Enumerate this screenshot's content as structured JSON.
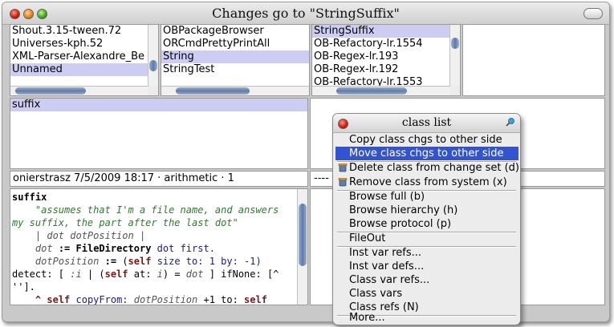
{
  "window": {
    "title": "Changes go to \"StringSuffix\""
  },
  "lists": {
    "changesets": [
      "Shout.3.15-tween.72",
      "Universes-kph.52",
      "XML-Parser-Alexandre_Be",
      "Unnamed"
    ],
    "classes": [
      "OBPackageBrowser",
      "ORCmdPrettyPrintAll",
      "String",
      "StringTest"
    ],
    "other_changesets": [
      "StringSuffix",
      "OB-Refactory-lr.1554",
      "OB-Regex-lr.193",
      "OB-Regex-lr.192",
      "OB-Refactory-lr.1553"
    ],
    "methods": [
      "suffix"
    ]
  },
  "info_line": "onierstrasz 7/5/2009 18:17 · arithmetic · 1",
  "right_info": "----",
  "code": {
    "selector": "suffix",
    "comment1": "\"assumes that I'm a file name, and answers",
    "comment2": "my suffix, the part after the last dot\"",
    "temps": "| dot dotPosition |",
    "l4_var": "dot",
    "l4_assign": ":=",
    "l4_class": "FileDirectory",
    "l4_rest": "dot first.",
    "l5_var": "dotPosition",
    "l5_assign": ":=",
    "l5_paren": "(",
    "l5_self": "self",
    "l5_rest": "size to: 1 by: -1)",
    "l6_a": "detect: [ ",
    "l6_b": ":i",
    "l6_c": " | (",
    "l6_d": "self",
    "l6_e": " at: ",
    "l6_f": "i",
    "l6_g": ") = ",
    "l6_h": "dot",
    "l6_i": " ] ifNone: [^",
    "l7": "''].",
    "l8_caret": "^",
    "l8_self": "self",
    "l8_a": " copyFrom: ",
    "l8_b": "dotPosition",
    "l8_c": " +1 to: ",
    "l8_d": "self"
  },
  "menu": {
    "title": "class list",
    "items": [
      "Copy class chgs to other side",
      "Move class chgs to other side",
      "Delete class from change set (d)",
      "Remove class from system (x)",
      "Browse full (b)",
      "Browse hierarchy (h)",
      "Browse protocol (p)",
      "FileOut",
      "Inst var refs...",
      "Inst var defs...",
      "Class var refs...",
      "Class vars",
      "Class refs (N)",
      "More..."
    ]
  },
  "colors": {
    "selection": "#cdcdf3",
    "menu_highlight": "#3354d1",
    "comment": "#2a7d2a"
  }
}
